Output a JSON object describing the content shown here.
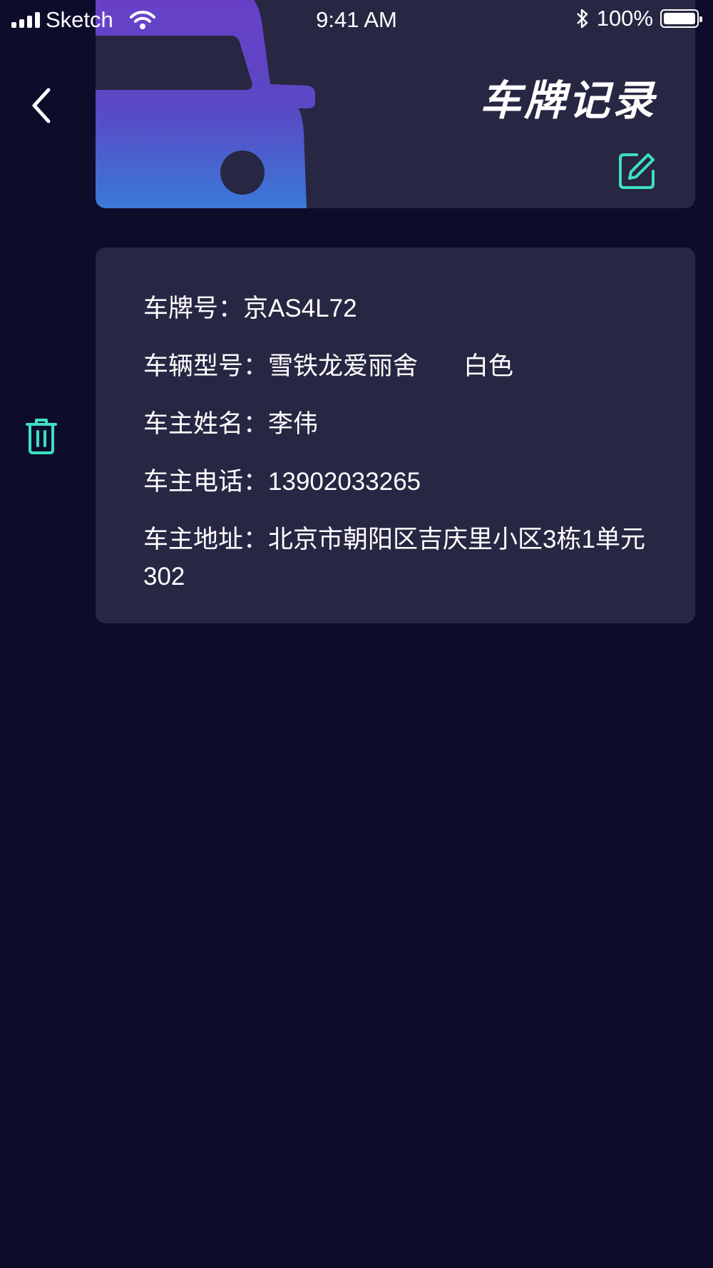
{
  "status_bar": {
    "carrier": "Sketch",
    "time": "9:41 AM",
    "battery": "100%"
  },
  "header": {
    "title": "车牌记录"
  },
  "vehicle": {
    "plate_label": "车牌号：",
    "plate_value": "京AS4L72",
    "model_label": "车辆型号：",
    "model_value": "雪铁龙爱丽舍",
    "color_value": "白色",
    "owner_name_label": "车主姓名：",
    "owner_name_value": "李伟",
    "owner_phone_label": "车主电话：",
    "owner_phone_value": "13902033265",
    "owner_address_label": "车主地址：",
    "owner_address_value": "北京市朝阳区吉庆里小区3栋1单元302"
  },
  "icons": {
    "back": "chevron-left-icon",
    "edit": "edit-icon",
    "delete": "trash-icon",
    "car": "car-icon"
  },
  "colors": {
    "background": "#0d0c2b",
    "card": "#272743",
    "accent": "#3fe0c0",
    "car_gradient_top": "#6a3fc8",
    "car_gradient_bottom": "#3a7ad8"
  }
}
